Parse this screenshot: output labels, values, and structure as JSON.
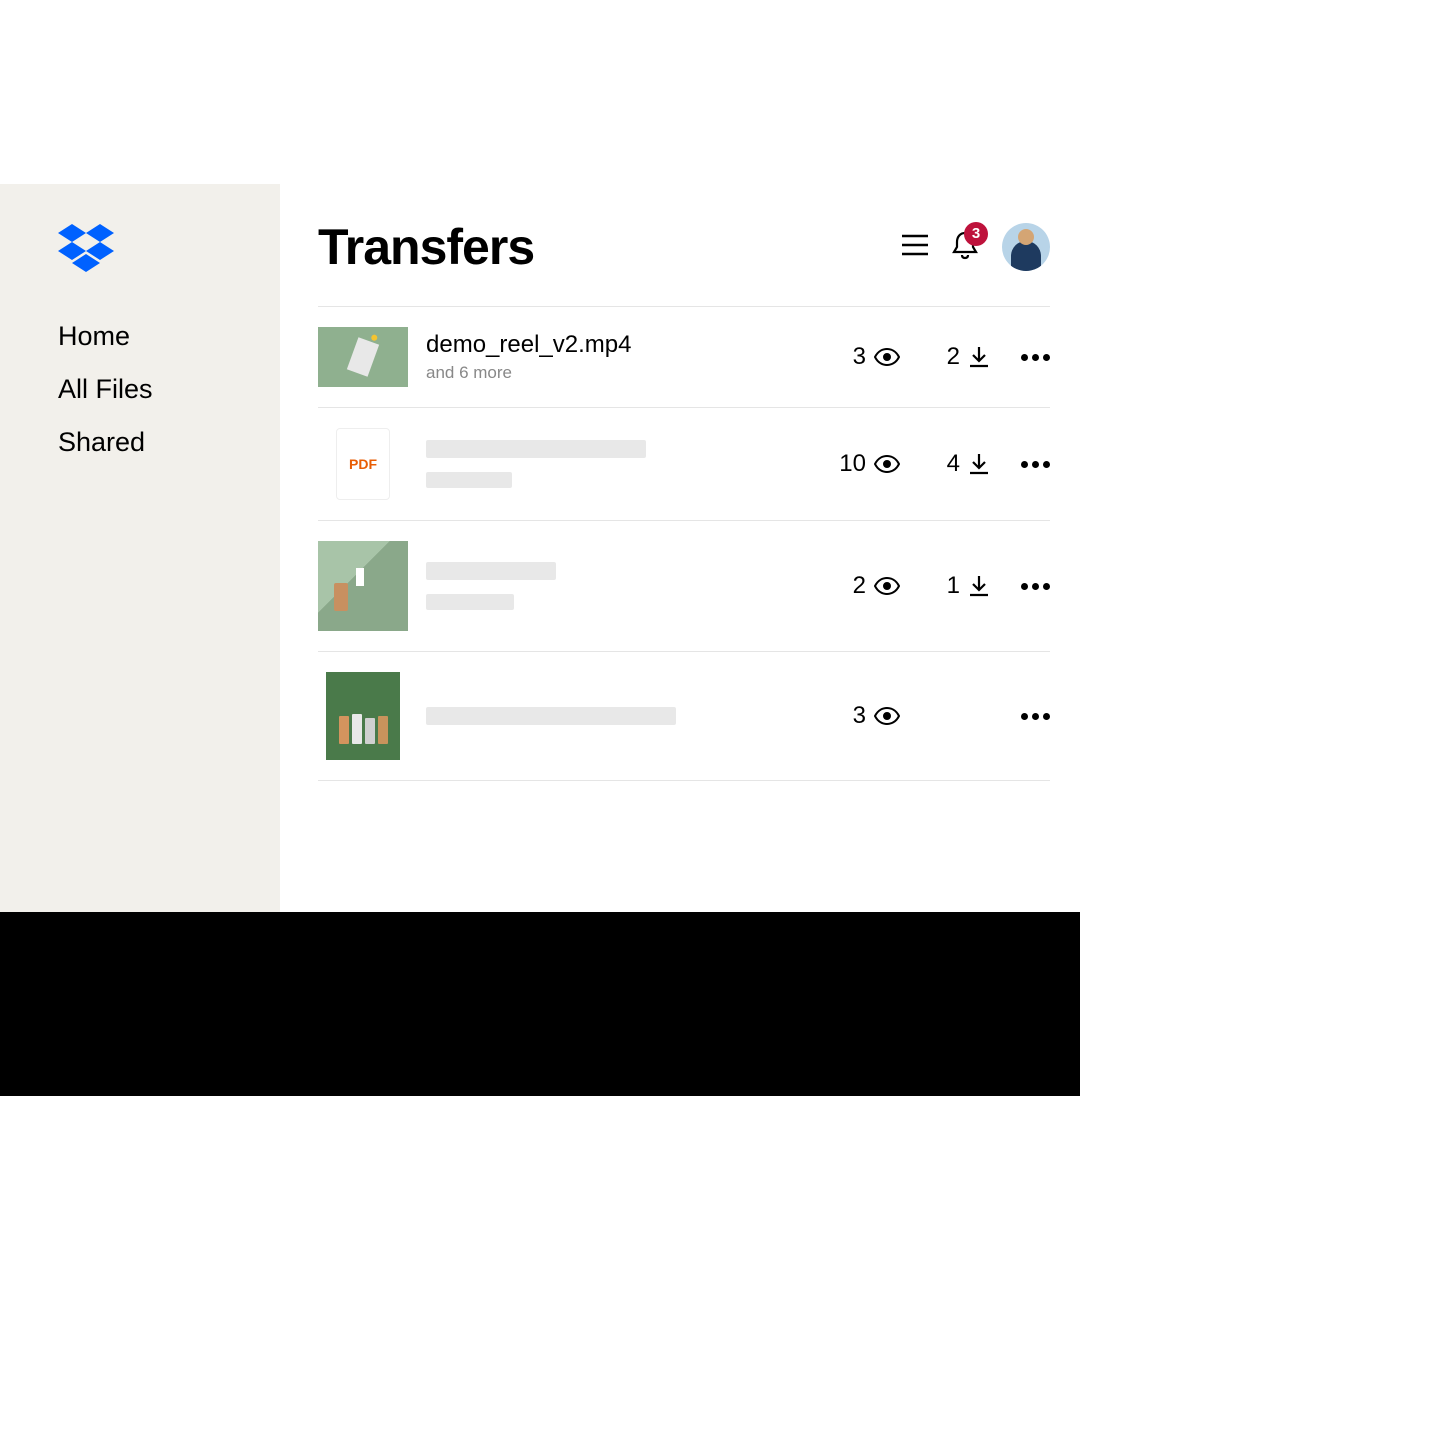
{
  "sidebar": {
    "items": [
      {
        "label": "Home"
      },
      {
        "label": "All Files"
      },
      {
        "label": "Shared"
      }
    ]
  },
  "header": {
    "title": "Transfers",
    "notification_count": "3"
  },
  "transfers": [
    {
      "name": "demo_reel_v2.mp4",
      "subtitle": "and 6 more",
      "views": "3",
      "downloads": "2",
      "thumb_type": "green-vase"
    },
    {
      "name": "",
      "subtitle": "",
      "views": "10",
      "downloads": "4",
      "thumb_type": "pdf",
      "pdf_label": "PDF"
    },
    {
      "name": "",
      "subtitle": "",
      "views": "2",
      "downloads": "1",
      "thumb_type": "green-bottles"
    },
    {
      "name": "",
      "subtitle": "",
      "views": "3",
      "downloads": "",
      "thumb_type": "green-bottles-row"
    }
  ]
}
